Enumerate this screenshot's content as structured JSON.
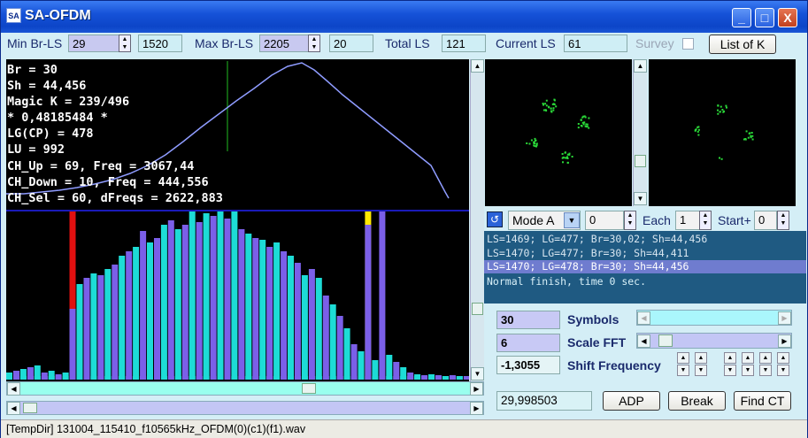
{
  "window": {
    "app_icon": "SA",
    "title": "SA-OFDM",
    "minimize": "_",
    "maximize": "□",
    "close": "X"
  },
  "toolbar": {
    "min_br_label": "Min Br-LS",
    "min_br_value": "29",
    "min_br_second": "1520",
    "max_br_label": "Max Br-LS",
    "max_br_value": "2205",
    "max_br_second": "20",
    "total_ls_label": "Total LS",
    "total_ls_value": "121",
    "current_ls_label": "Current LS",
    "current_ls_value": "61",
    "survey_label": "Survey",
    "list_button": "List of K"
  },
  "info": {
    "lines": [
      "Br = 30",
      "Sh = 44,456",
      "Magic K = 239/496",
      "* 0,48185484 *",
      "LG(CP) = 478",
      "LU = 992",
      "CH_Up = 69, Freq = 3067,44",
      "CH_Down = 10, Freq = 444,556",
      "CH_Sel = 60, dFreqs = 2622,883"
    ]
  },
  "curve_color": "#8f9cff",
  "spectrum": {
    "colors": {
      "cyan": "#1ddcd6",
      "purple": "#7b5fe8",
      "red": "#e01010",
      "yellow": "#ffe800"
    },
    "bars": [
      {
        "c": "cyan",
        "v": 8
      },
      {
        "c": "purple",
        "v": 10
      },
      {
        "c": "cyan",
        "v": 12
      },
      {
        "c": "purple",
        "v": 14
      },
      {
        "c": "cyan",
        "v": 16
      },
      {
        "c": "purple",
        "v": 8
      },
      {
        "c": "cyan",
        "v": 10
      },
      {
        "c": "purple",
        "v": 6
      },
      {
        "c": "cyan",
        "v": 8
      },
      {
        "c": "red",
        "v": 190
      },
      {
        "c": "cyan",
        "v": 108
      },
      {
        "c": "purple",
        "v": 115
      },
      {
        "c": "cyan",
        "v": 120
      },
      {
        "c": "purple",
        "v": 118
      },
      {
        "c": "cyan",
        "v": 125
      },
      {
        "c": "purple",
        "v": 130
      },
      {
        "c": "cyan",
        "v": 140
      },
      {
        "c": "purple",
        "v": 145
      },
      {
        "c": "cyan",
        "v": 150
      },
      {
        "c": "purple",
        "v": 168
      },
      {
        "c": "cyan",
        "v": 155
      },
      {
        "c": "purple",
        "v": 160
      },
      {
        "c": "cyan",
        "v": 175
      },
      {
        "c": "purple",
        "v": 180
      },
      {
        "c": "cyan",
        "v": 170
      },
      {
        "c": "purple",
        "v": 175
      },
      {
        "c": "cyan",
        "v": 190
      },
      {
        "c": "purple",
        "v": 178
      },
      {
        "c": "cyan",
        "v": 188
      },
      {
        "c": "purple",
        "v": 185
      },
      {
        "c": "cyan",
        "v": 190
      },
      {
        "c": "purple",
        "v": 182
      },
      {
        "c": "cyan",
        "v": 190
      },
      {
        "c": "purple",
        "v": 170
      },
      {
        "c": "cyan",
        "v": 165
      },
      {
        "c": "purple",
        "v": 160
      },
      {
        "c": "cyan",
        "v": 158
      },
      {
        "c": "purple",
        "v": 150
      },
      {
        "c": "cyan",
        "v": 155
      },
      {
        "c": "purple",
        "v": 145
      },
      {
        "c": "cyan",
        "v": 140
      },
      {
        "c": "purple",
        "v": 132
      },
      {
        "c": "cyan",
        "v": 118
      },
      {
        "c": "purple",
        "v": 125
      },
      {
        "c": "cyan",
        "v": 115
      },
      {
        "c": "purple",
        "v": 95
      },
      {
        "c": "cyan",
        "v": 85
      },
      {
        "c": "purple",
        "v": 72
      },
      {
        "c": "cyan",
        "v": 58
      },
      {
        "c": "purple",
        "v": 40
      },
      {
        "c": "cyan",
        "v": 32
      },
      {
        "c": "yellow",
        "v": 190
      },
      {
        "c": "cyan",
        "v": 22
      },
      {
        "c": "purple",
        "v": 190
      },
      {
        "c": "cyan",
        "v": 28
      },
      {
        "c": "purple",
        "v": 20
      },
      {
        "c": "cyan",
        "v": 14
      },
      {
        "c": "purple",
        "v": 8
      },
      {
        "c": "cyan",
        "v": 6
      },
      {
        "c": "purple",
        "v": 5
      },
      {
        "c": "cyan",
        "v": 6
      },
      {
        "c": "purple",
        "v": 5
      },
      {
        "c": "cyan",
        "v": 4
      },
      {
        "c": "purple",
        "v": 5
      },
      {
        "c": "cyan",
        "v": 4
      }
    ],
    "bar_overlay": [
      {
        "i": 9,
        "c": "purple",
        "v": 80
      },
      {
        "i": 51,
        "c": "purple",
        "v": 175
      }
    ]
  },
  "constellation_color": "#2ad838",
  "controls": {
    "mode_value": "Mode A",
    "mode_number": "0",
    "each_label": "Each",
    "each_value": "1",
    "start_label": "Start+",
    "start_value": "0"
  },
  "log": {
    "lines": [
      "LS=1469; LG=477; Br=30,02; Sh=44,456",
      "LS=1470; LG=477; Br=30; Sh=44,411",
      "LS=1470; LG=478; Br=30; Sh=44,456",
      "Normal finish, time 0 sec."
    ]
  },
  "params": {
    "symbols_value": "30",
    "symbols_label": "Symbols",
    "scale_value": "6",
    "scale_label": "Scale FFT",
    "shift_value": "-1,3055",
    "shift_label": "Shift Frequency",
    "freq_value": "29,998503",
    "adp_button": "ADP",
    "break_button": "Break",
    "find_button": "Find CT"
  },
  "status": {
    "text": "[TempDir] 131004_115410_f10565kHz_OFDM(0)(c1)(f1).wav"
  }
}
